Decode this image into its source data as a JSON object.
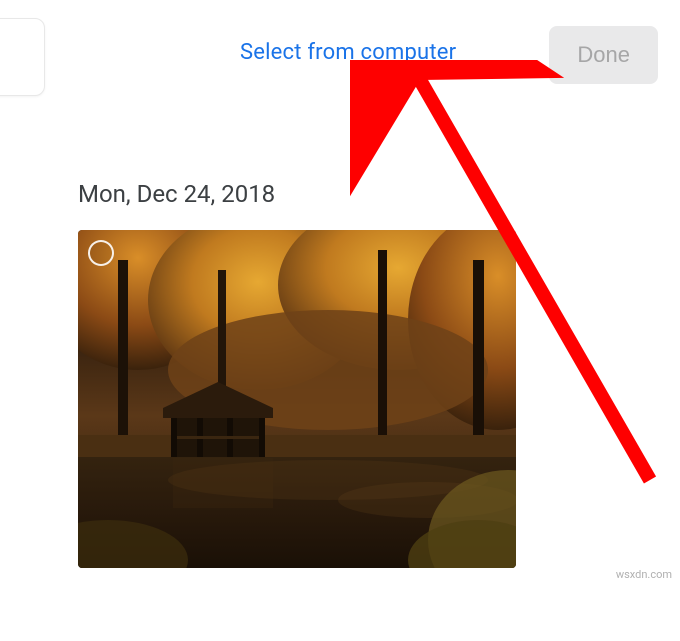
{
  "header": {
    "select_link_label": "Select from computer",
    "done_button_label": "Done"
  },
  "content": {
    "group_date": "Mon, Dec 24, 2018"
  },
  "watermark": "wsxdn.com",
  "colors": {
    "link": "#1a73e8",
    "done_bg": "#e9e9ea",
    "done_text": "#a6a6a7",
    "arrow": "#fe0000"
  }
}
